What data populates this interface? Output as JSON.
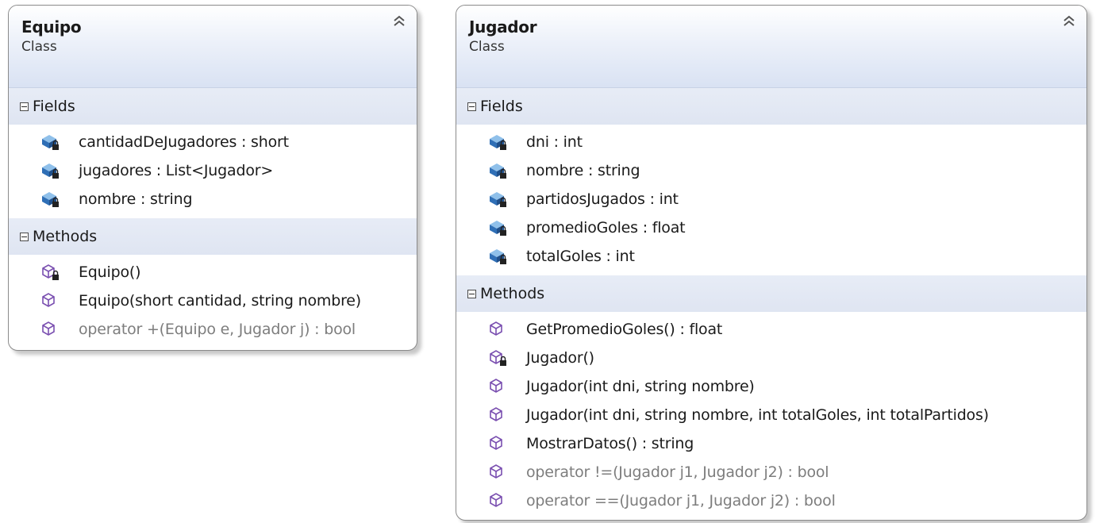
{
  "classes": {
    "equipo": {
      "name": "Equipo",
      "kind": "Class",
      "fields_label": "Fields",
      "fields": [
        "cantidadDeJugadores : short",
        "jugadores : List<Jugador>",
        "nombre : string"
      ],
      "methods_label": "Methods",
      "methods": [
        "Equipo()",
        "Equipo(short cantidad, string nombre)",
        "operator +(Equipo e, Jugador j) : bool"
      ]
    },
    "jugador": {
      "name": "Jugador",
      "kind": "Class",
      "fields_label": "Fields",
      "fields": [
        "dni : int",
        "nombre : string",
        "partidosJugados : int",
        "promedioGoles : float",
        "totalGoles : int"
      ],
      "methods_label": "Methods",
      "methods": [
        "GetPromedioGoles() : float",
        "Jugador()",
        "Jugador(int dni, string nombre)",
        "Jugador(int dni, string nombre, int totalGoles, int totalPartidos)",
        "MostrarDatos() : string",
        "operator !=(Jugador j1, Jugador j2) : bool",
        "operator ==(Jugador j1, Jugador j2) : bool"
      ]
    }
  },
  "icons": {
    "collapse": "double-chevron-up-icon",
    "field": "private-field-icon",
    "method": "public-method-icon",
    "private_method": "private-method-icon",
    "expander": "minus-toggle-icon"
  },
  "colors": {
    "header_gradient_end": "#d9e2f3",
    "compartment_bg": "#e2e8f4",
    "field_icon": "#2f6fb6",
    "method_icon": "#7a4fb0",
    "inherited_text": "#7d7d7d"
  }
}
